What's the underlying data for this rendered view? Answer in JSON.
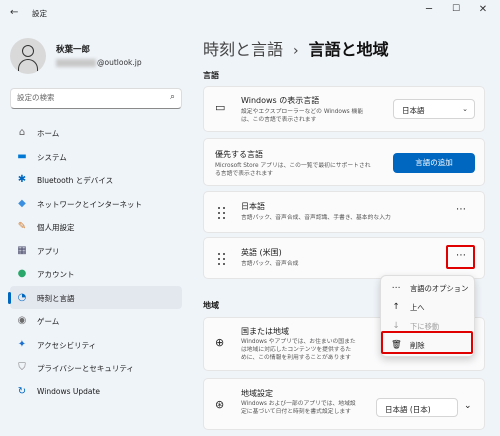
{
  "window": {
    "back_glyph": "←",
    "title": "設定",
    "controls": [
      "─",
      "☐",
      "✕"
    ]
  },
  "profile": {
    "name": "秋葉一郎",
    "email_visible": "@outlook.jp"
  },
  "search": {
    "placeholder": "設定の検索"
  },
  "sidebar": {
    "items": [
      {
        "label": "ホーム",
        "icon": "home-icon",
        "glyph": "⌂",
        "color": "#666666"
      },
      {
        "label": "システム",
        "icon": "monitor-icon",
        "glyph": "▬",
        "color": "#0078d4"
      },
      {
        "label": "Bluetooth とデバイス",
        "icon": "bluetooth-icon",
        "glyph": "✱",
        "color": "#0067c0"
      },
      {
        "label": "ネットワークとインターネット",
        "icon": "wifi-icon",
        "glyph": "◆",
        "color": "#3b8fe0"
      },
      {
        "label": "個人用設定",
        "icon": "brush-icon",
        "glyph": "✎",
        "color": "#d27b2a"
      },
      {
        "label": "アプリ",
        "icon": "apps-icon",
        "glyph": "▦",
        "color": "#4a4a6a"
      },
      {
        "label": "アカウント",
        "icon": "account-icon",
        "glyph": "●",
        "color": "#2aa86b"
      },
      {
        "label": "時刻と言語",
        "icon": "time-language-icon",
        "glyph": "◔",
        "color": "#0067c0"
      },
      {
        "label": "ゲーム",
        "icon": "gamepad-icon",
        "glyph": "◉",
        "color": "#6c6c6c"
      },
      {
        "label": "アクセシビリティ",
        "icon": "accessibility-icon",
        "glyph": "✦",
        "color": "#1a6fd0"
      },
      {
        "label": "プライバシーとセキュリティ",
        "icon": "shield-icon",
        "glyph": "⛉",
        "color": "#7a7a7a"
      },
      {
        "label": "Windows Update",
        "icon": "update-icon",
        "glyph": "↻",
        "color": "#0067c0"
      }
    ],
    "active_index": 7
  },
  "breadcrumb": {
    "parent": "時刻と言語",
    "separator": "›",
    "current": "言語と地域"
  },
  "language_section": {
    "header": "言語",
    "display_language": {
      "title": "Windows の表示言語",
      "desc_line1": "設定やエクスプローラーなどの Windows 機能",
      "desc_line2": "は、この言語で表示されます",
      "value": "日本語",
      "icon": "monitor-icon"
    },
    "preferred": {
      "title": "優先する言語",
      "desc_line1": "Microsoft Store アプリは、この一覧で最初にサポートされ",
      "desc_line2": "る言語で表示されます",
      "button": "言語の追加"
    },
    "languages": [
      {
        "name": "日本語",
        "features": "言語パック、音声合成、音声認識、手書き、基本的な入力"
      },
      {
        "name": "英語 (米国)",
        "features": "言語パック、音声合成"
      }
    ]
  },
  "context_menu": {
    "items": [
      {
        "label": "言語のオプション",
        "icon": "more-icon",
        "glyph": "⋯",
        "enabled": true
      },
      {
        "label": "上へ",
        "icon": "arrow-up-icon",
        "glyph": "↑",
        "enabled": true
      },
      {
        "label": "下に移動",
        "icon": "arrow-down-icon",
        "glyph": "↓",
        "enabled": false
      },
      {
        "label": "削除",
        "icon": "trash-icon",
        "glyph": "🗑",
        "enabled": true
      }
    ]
  },
  "region_section": {
    "header": "地域",
    "country": {
      "title": "国または地域",
      "desc_line1": "Windows やアプリでは、お住まいの国また",
      "desc_line2": "は地域に対応したコンテンツを提供するた",
      "desc_line3": "めに、この情報を利用することがあります",
      "icon": "globe-icon"
    },
    "format": {
      "title": "地域設定",
      "desc_line1": "Windows および一部のアプリでは、地域設",
      "desc_line2": "定に基づいて日付と時刻を書式設定します",
      "value": "日本語 (日本)",
      "icon": "region-format-icon"
    }
  },
  "colors": {
    "accent": "#0067c0",
    "highlight_box": "#e00000",
    "background": "#eff4f9",
    "card": "#fbfbfc"
  }
}
